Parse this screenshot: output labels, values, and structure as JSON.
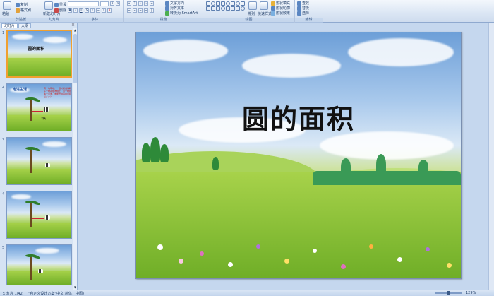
{
  "ribbon": {
    "clipboard": {
      "copy": "复制",
      "format_painter": "格式刷",
      "paste": "粘贴",
      "label": "剪贴板"
    },
    "slides": {
      "new_slide": "新建幻灯片",
      "reset": "重设",
      "delete": "删除",
      "label": "幻灯片"
    },
    "font": {
      "label": "字体",
      "font_name": "",
      "font_size": ""
    },
    "paragraph": {
      "label": "段落",
      "text_direction": "文字方向",
      "align_text": "对齐文本",
      "smartart": "转换为 SmartArt"
    },
    "drawing": {
      "label": "绘图",
      "arrange": "排列",
      "quick_styles": "快速样式",
      "shape_fill": "形状填充",
      "shape_outline": "形状轮廓",
      "shape_effects": "形状效果"
    },
    "editing": {
      "label": "编辑",
      "find": "查找",
      "replace": "替换",
      "select": "选择"
    }
  },
  "left_panel": {
    "tabs": [
      "幻灯片",
      "大纲"
    ],
    "close": "×",
    "slides": [
      {
        "number": "1",
        "title": "圆的面积"
      },
      {
        "number": "2",
        "title": "走进生活",
        "text": "有一块草地，一根5米长的绳子一端系在木桩上，另一端拴着一只羊，羊能吃到草的面积是多少？",
        "label": "2米"
      },
      {
        "number": "3"
      },
      {
        "number": "4"
      },
      {
        "number": "5"
      }
    ]
  },
  "main_slide": {
    "title": "圆的面积"
  },
  "status_bar": {
    "slide_info": "幻灯片 1/42",
    "theme": "\"自定义设计方案\"",
    "language": "中文(简体，中国)",
    "zoom": "129%"
  },
  "colors": {
    "accent": "#2b579a",
    "selected_border": "#f0a030",
    "ribbon_bg": "#dbe6f4"
  }
}
